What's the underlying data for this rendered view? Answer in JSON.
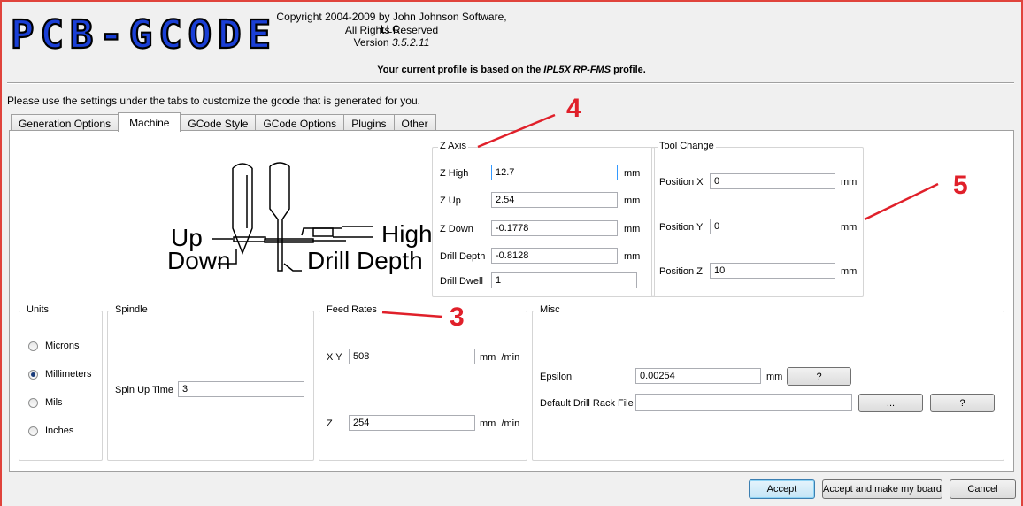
{
  "header": {
    "logo_text": "PCB-GCODE",
    "copyright": "Copyright 2004-2009 by John Johnson Software, LLC.",
    "rights": "All Rights Reserved",
    "version_label": "Version",
    "version_value": "3.5.2.11",
    "profile_prefix": "Your current profile is based on the",
    "profile_name": "IPL5X RP-FMS",
    "profile_suffix": "profile."
  },
  "instructions": "Please use the settings under the tabs to customize the gcode that is generated for you.",
  "tabs": [
    {
      "label": "Generation Options"
    },
    {
      "label": "Machine",
      "active": true
    },
    {
      "label": "GCode Style"
    },
    {
      "label": "GCode Options"
    },
    {
      "label": "Plugins"
    },
    {
      "label": "Other"
    }
  ],
  "diagram": {
    "up": "Up",
    "down": "Down",
    "high": "High",
    "drill_depth": "Drill Depth"
  },
  "z_axis": {
    "title": "Z Axis",
    "rows": [
      {
        "label": "Z High",
        "value": "12.7",
        "unit": "mm"
      },
      {
        "label": "Z Up",
        "value": "2.54",
        "unit": "mm"
      },
      {
        "label": "Z Down",
        "value": "-0.1778",
        "unit": "mm"
      },
      {
        "label": "Drill Depth",
        "value": "-0.8128",
        "unit": "mm"
      },
      {
        "label": "Drill Dwell",
        "value": "1"
      }
    ]
  },
  "tool_change": {
    "title": "Tool Change",
    "rows": [
      {
        "label": "Position X",
        "value": "0",
        "unit": "mm"
      },
      {
        "label": "Position Y",
        "value": "0",
        "unit": "mm"
      },
      {
        "label": "Position Z",
        "value": "10",
        "unit": "mm"
      }
    ]
  },
  "units": {
    "title": "Units",
    "options": [
      "Microns",
      "Millimeters",
      "Mils",
      "Inches"
    ],
    "selected": "Millimeters"
  },
  "spindle": {
    "title": "Spindle",
    "spin_up_label": "Spin Up Time",
    "spin_up_value": "3"
  },
  "feed_rates": {
    "title": "Feed Rates",
    "xy_label": "X Y",
    "xy_value": "508",
    "z_label": "Z",
    "z_value": "254",
    "unit": "mm",
    "per": "/min"
  },
  "misc": {
    "title": "Misc",
    "epsilon_label": "Epsilon",
    "epsilon_value": "0.00254",
    "epsilon_unit": "mm",
    "help_label": "?",
    "rack_label": "Default Drill Rack File",
    "rack_value": "",
    "browse_label": "..."
  },
  "buttons": {
    "accept": "Accept",
    "accept_make": "Accept and make my board",
    "cancel": "Cancel"
  },
  "annotations": [
    "4",
    "5",
    "3"
  ],
  "colors": {
    "annotation": "#e0202a",
    "logo": "#1a3fd6",
    "frame": "#e0433c"
  }
}
